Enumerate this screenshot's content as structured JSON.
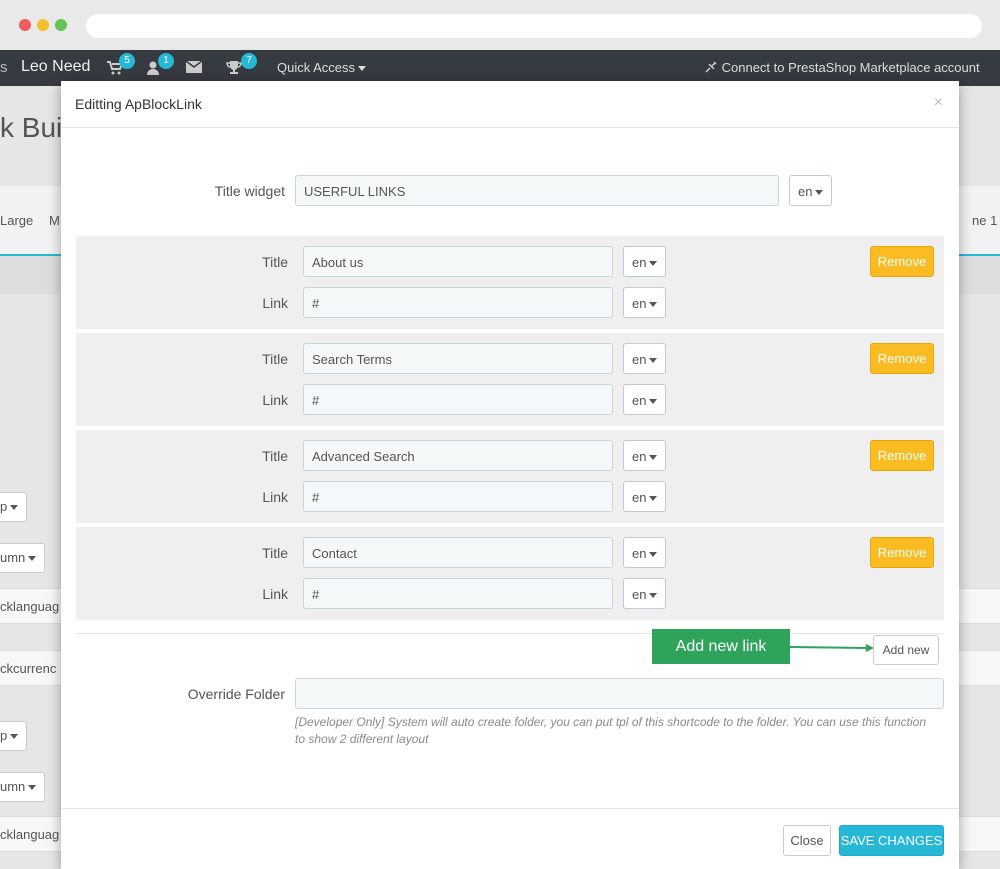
{
  "browser": {
    "url": ""
  },
  "topnav": {
    "crumb": "s",
    "shop_name": "Leo Need",
    "cart_count": "5",
    "customer_count": "1",
    "trophy_count": "7",
    "quick_access": "Quick Access",
    "connect": "Connect to PrestaShop Marketplace account"
  },
  "background": {
    "page_title": "k Bui",
    "bar_left": "Large",
    "bar_left2": "M",
    "bar_right": "ne 1",
    "items": [
      "p",
      "umn",
      "cklanguag",
      "ckcurrenc",
      "p",
      "umn",
      "cklanguag"
    ]
  },
  "modal": {
    "title": "Editting ApBlockLink",
    "close_x": "×",
    "title_widget_label": "Title widget",
    "title_widget_value": "USERFUL LINKS",
    "lang": "en",
    "title_label": "Title",
    "link_label": "Link",
    "remove_label": "Remove",
    "links": [
      {
        "title": "About us",
        "link": "#"
      },
      {
        "title": "Search Terms",
        "link": "#"
      },
      {
        "title": "Advanced Search",
        "link": "#"
      },
      {
        "title": "Contact",
        "link": "#"
      }
    ],
    "add_new_label": "Add new",
    "annotation": "Add new link",
    "override_label": "Override Folder",
    "override_value": "",
    "help_text": "[Developer Only] System will auto create folder, you can put tpl of this shortcode to the folder. You can use this function to show 2 different layout",
    "close_label": "Close",
    "save_label": "SAVE CHANGES"
  },
  "colors": {
    "accent": "#25b9d7",
    "remove": "#fbbb22",
    "annotation": "#2ea35a",
    "nav": "#363a41"
  }
}
